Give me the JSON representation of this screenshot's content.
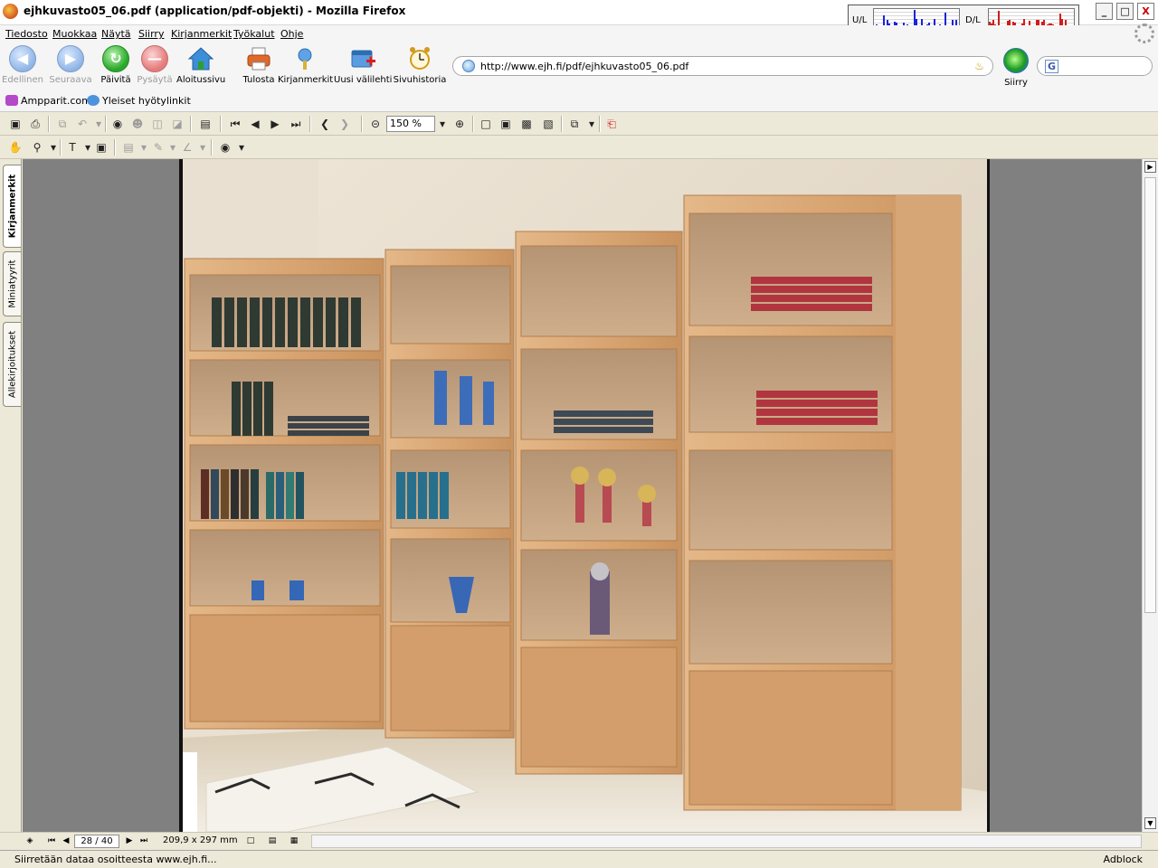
{
  "window": {
    "title": "ejhkuvasto05_06.pdf (application/pdf-objekti) - Mozilla Firefox",
    "minimize": "_",
    "maximize": "□",
    "close": "X"
  },
  "netmonitor": {
    "upload_label": "U/L",
    "download_label": "D/L",
    "upload_color": "#1c24d6",
    "download_color": "#d21c1c"
  },
  "menu": [
    "Tiedosto",
    "Muokkaa",
    "Näytä",
    "Siirry",
    "Kirjanmerkit",
    "Työkalut",
    "Ohje"
  ],
  "navigation": {
    "back": "Edellinen",
    "forward": "Seuraava",
    "reload": "Päivitä",
    "stop": "Pysäytä",
    "home": "Aloitussivu",
    "print": "Tulosta",
    "bookmarks": "Kirjanmerkit",
    "new_tab": "Uusi välilehti",
    "history": "Sivuhistoria",
    "go": "Siirry"
  },
  "address": {
    "url": "http://www.ejh.fi/pdf/ejhkuvasto05_06.pdf"
  },
  "search": {
    "engine_letter": "G",
    "value": ""
  },
  "bookmarks_bar": [
    "Ampparit.com",
    "Yleiset hyötylinkit"
  ],
  "pdf_toolbar": {
    "zoom": "150 %"
  },
  "side_tabs": [
    "Kirjanmerkit",
    "Miniatyyrit",
    "Allekirjoitukset"
  ],
  "pdf_nav": {
    "page": "28 / 40",
    "page_size": "209,9 x 297 mm"
  },
  "status": {
    "text": "Siirretään dataa osoitteesta www.ejh.fi...",
    "adblock": "Adblock"
  },
  "colors": {
    "wood": "#d9a878",
    "wall": "#e6dccd",
    "toolbar_bg": "#ece9d8"
  }
}
